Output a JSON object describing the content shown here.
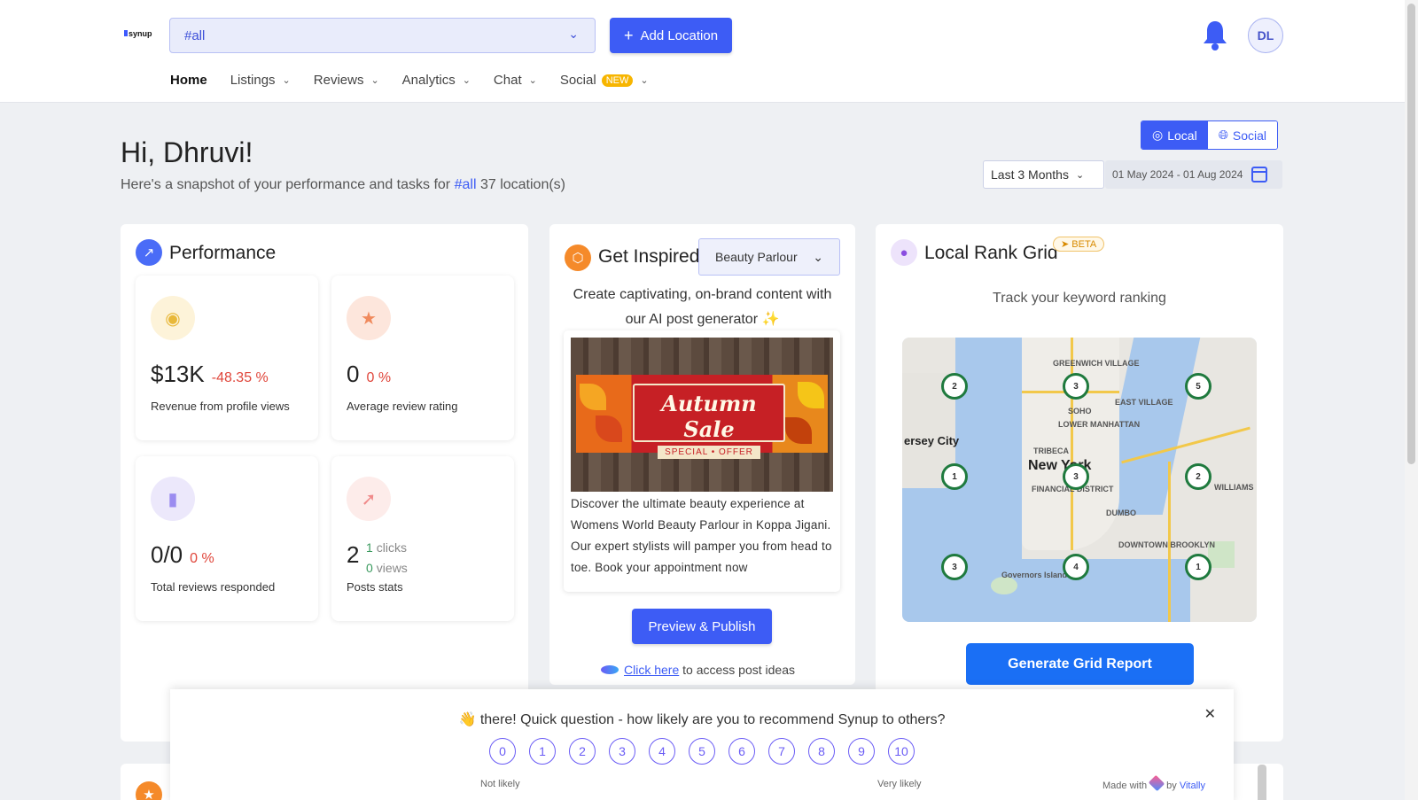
{
  "header": {
    "logo": "synup",
    "location_select": "#all",
    "add_location": "Add Location",
    "avatar_initials": "DL"
  },
  "nav": [
    {
      "label": "Home"
    },
    {
      "label": "Listings"
    },
    {
      "label": "Reviews"
    },
    {
      "label": "Analytics"
    },
    {
      "label": "Chat"
    },
    {
      "label": "Social",
      "badge": "NEW"
    }
  ],
  "greeting": {
    "title": "Hi, Dhruvi!",
    "sub_prefix": "Here's a snapshot of your performance and tasks for",
    "sub_tag": "#all",
    "sub_suffix": "37 location(s)"
  },
  "view_toggle": {
    "local": "Local",
    "social": "Social"
  },
  "date_range": {
    "preset": "Last 3 Months",
    "dates": "01 May 2024 - 01 Aug 2024"
  },
  "performance": {
    "title": "Performance",
    "tiles": [
      {
        "value": "$13K",
        "change": "-48.35 %",
        "label": "Revenue from profile views"
      },
      {
        "value": "0",
        "change": "0 %",
        "label": "Average review rating"
      },
      {
        "value": "0/0",
        "change": "0 %",
        "label": "Total reviews responded"
      },
      {
        "value": "2",
        "clicks": "1",
        "clicks_label": "clicks",
        "views": "0",
        "views_label": "views",
        "label": "Posts stats"
      }
    ]
  },
  "inspire": {
    "title": "Get Inspired",
    "category": "Beauty Parlour",
    "line1": "Create captivating, on-brand content with",
    "line2": "our AI post generator ✨",
    "banner_title": "Autumn Sale",
    "banner_sub": "SPECIAL • OFFER",
    "post_text": "Discover the ultimate beauty experience at Womens World Beauty Parlour in Koppa Jigani. Our expert stylists will pamper you from head to toe. Book your appointment now",
    "preview_button": "Preview & Publish",
    "link_text": "Click here",
    "link_suffix": " to access post ideas"
  },
  "rank_grid": {
    "title": "Local Rank Grid",
    "badge": "BETA",
    "subtitle": "Track your keyword ranking",
    "map_labels": {
      "city": "New York",
      "jersey": "ersey City",
      "soho": "SOHO",
      "village": "GREENWICH VILLAGE",
      "east": "EAST VILLAGE",
      "lower": "LOWER MANHATTAN",
      "tribeca": "TRIBECA",
      "financial": "FINANCIAL DISTRICT",
      "dumbo": "DUMBO",
      "downtown": "DOWNTOWN BROOKLYN",
      "governors": "Governors Island",
      "williams": "WILLIAMS"
    },
    "pins": [
      "2",
      "3",
      "5",
      "1",
      "3",
      "2",
      "3",
      "4",
      "1"
    ],
    "button": "Generate Grid Report"
  },
  "survey": {
    "question": "👋 there! Quick question - how likely are you to recommend Synup to others?",
    "scale": [
      "0",
      "1",
      "2",
      "3",
      "4",
      "5",
      "6",
      "7",
      "8",
      "9",
      "10"
    ],
    "low_label": "Not likely",
    "high_label": "Very likely",
    "made_with": "Made with",
    "by": "by",
    "brand": "Vitally"
  }
}
